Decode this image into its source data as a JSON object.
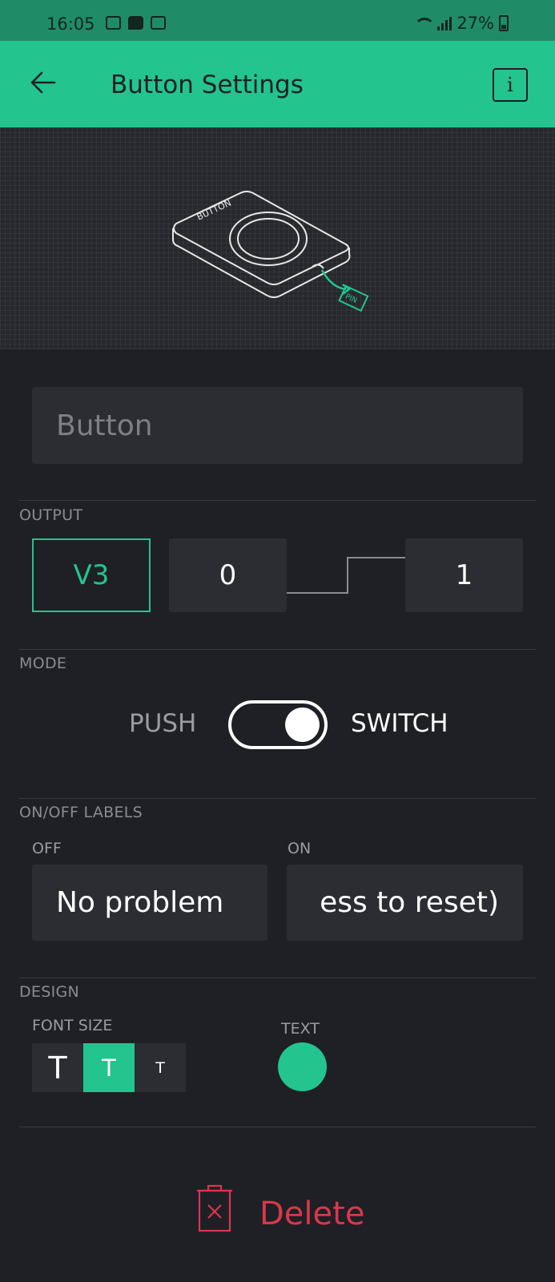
{
  "status_bar": {
    "time": "16:05",
    "battery": "27%"
  },
  "app_bar": {
    "title": "Button Settings",
    "info_label": "i"
  },
  "preview": {
    "widget_label": "BUTTON",
    "pin_label": "PIN"
  },
  "name_field": {
    "placeholder": "Button"
  },
  "output": {
    "section_label": "OUTPUT",
    "pin": "V3",
    "low_value": "0",
    "high_value": "1"
  },
  "mode": {
    "section_label": "MODE",
    "push_label": "PUSH",
    "switch_label": "SWITCH",
    "switch_selected": true
  },
  "labels": {
    "section_label": "ON/OFF LABELS",
    "off_label": "OFF",
    "on_label": "ON",
    "off_value": "No problem",
    "on_value": "ess to reset)"
  },
  "design": {
    "section_label": "DESIGN",
    "font_size_label": "FONT SIZE",
    "text_label": "TEXT",
    "font_sizes": [
      "T",
      "T",
      "T"
    ],
    "selected_font_size": 1,
    "text_color": "#23c48e"
  },
  "delete": {
    "label": "Delete"
  },
  "colors": {
    "accent": "#23c48e",
    "danger": "#d9374a",
    "background": "#1e2025"
  }
}
